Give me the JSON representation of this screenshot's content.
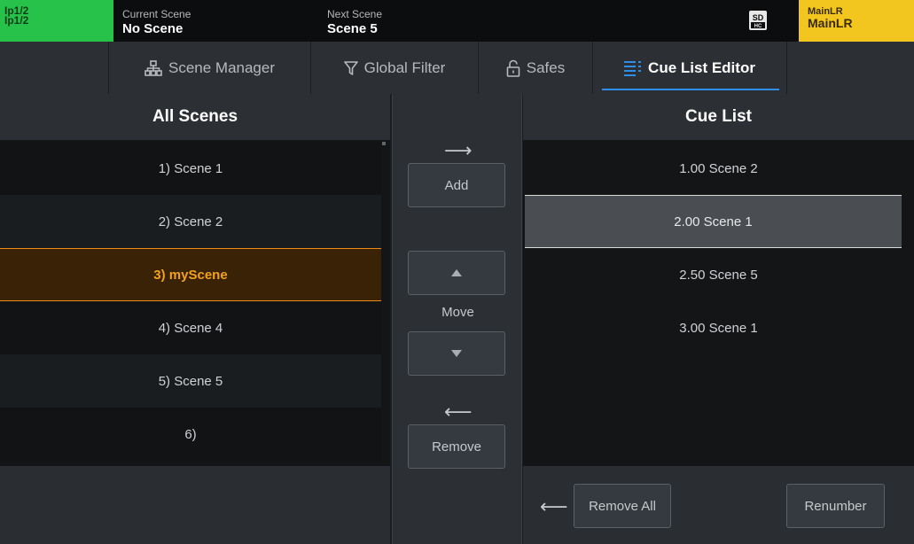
{
  "status_bar": {
    "channel_line1": "Ip1/2",
    "channel_line2": "Ip1/2",
    "current_scene_label": "Current Scene",
    "current_scene_value": "No Scene",
    "next_scene_label": "Next Scene",
    "next_scene_value": "Scene 5",
    "sd_icon": "sd-card-icon",
    "bus_line1": "MainLR",
    "bus_line2": "MainLR",
    "colors": {
      "channel": "#27c24a",
      "bus": "#f2c61f"
    }
  },
  "tabs": [
    {
      "label": "Scene Manager",
      "icon": "hierarchy-icon"
    },
    {
      "label": "Global Filter",
      "icon": "filter-icon"
    },
    {
      "label": "Safes",
      "icon": "lock-icon"
    },
    {
      "label": "Cue List Editor",
      "icon": "list-icon",
      "active": true
    }
  ],
  "all_scenes": {
    "title": "All Scenes",
    "items": [
      "1) Scene 1",
      "2) Scene 2",
      "3) myScene",
      "4) Scene 4",
      "5) Scene 5",
      "6)"
    ],
    "selected_index": 2
  },
  "actions": {
    "add_arrow": "⟶",
    "add_label": "Add",
    "move_label": "Move",
    "remove_arrow": "⟵",
    "remove_label": "Remove"
  },
  "cue_list": {
    "title": "Cue List",
    "items": [
      "1.00 Scene 2",
      "2.00 Scene 1",
      "2.50 Scene 5",
      "3.00 Scene 1"
    ],
    "selected_index": 1,
    "remove_all_arrow": "⟵",
    "remove_all_label": "Remove All",
    "renumber_label": "Renumber"
  },
  "accent_colors": {
    "selection_orange": "#f4a21b",
    "tab_underline": "#2f8ee8"
  }
}
